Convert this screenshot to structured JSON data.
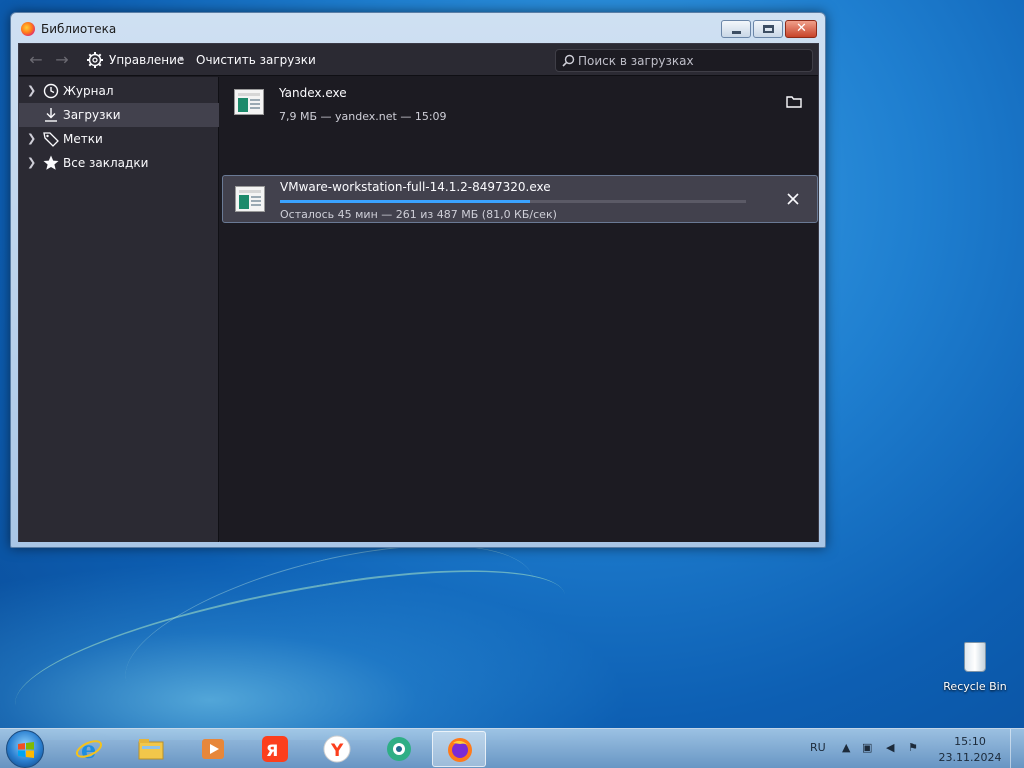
{
  "window": {
    "title": "Библиотека",
    "caption_buttons": [
      "minimize",
      "maximize",
      "close"
    ]
  },
  "toolbar": {
    "manage_label": "Управление",
    "clear_label": "Очистить загрузки",
    "search_placeholder": "Поиск в загрузках"
  },
  "sidebar": {
    "items": [
      {
        "label": "Журнал",
        "icon": "clock-icon",
        "expandable": true,
        "selected": false
      },
      {
        "label": "Загрузки",
        "icon": "download-icon",
        "expandable": false,
        "selected": true
      },
      {
        "label": "Метки",
        "icon": "tag-icon",
        "expandable": true,
        "selected": false
      },
      {
        "label": "Все закладки",
        "icon": "star-icon",
        "expandable": true,
        "selected": false
      }
    ]
  },
  "downloads": [
    {
      "name": "Yandex.exe",
      "status": "7,9 МБ — yandex.net — 15:09",
      "action_icon": "folder-icon",
      "selected": false
    },
    {
      "name": "VMware-workstation-full-14.1.2-8497320.exe",
      "status": "Осталось 45 мин — 261 из 487 МБ (81,0 КБ/сек)",
      "progress": 0.536,
      "action_icon": "cancel-icon",
      "selected": true
    }
  ],
  "taskbar": {
    "apps": [
      "internet-explorer-icon",
      "file-explorer-icon",
      "media-player-icon",
      "yandex-icon",
      "yandex-browser-icon",
      "chat-app-icon",
      "firefox-icon"
    ],
    "active_app": "firefox-icon",
    "language": "RU",
    "time": "15:10",
    "date": "23.11.2024"
  },
  "desktop": {
    "recycle_bin_label": "Recycle Bin"
  },
  "colors": {
    "accent": "#3aa3ff",
    "panel_bg": "#1c1b22",
    "sidebar_bg": "#2b2a33",
    "selected_bg": "#42414d"
  }
}
